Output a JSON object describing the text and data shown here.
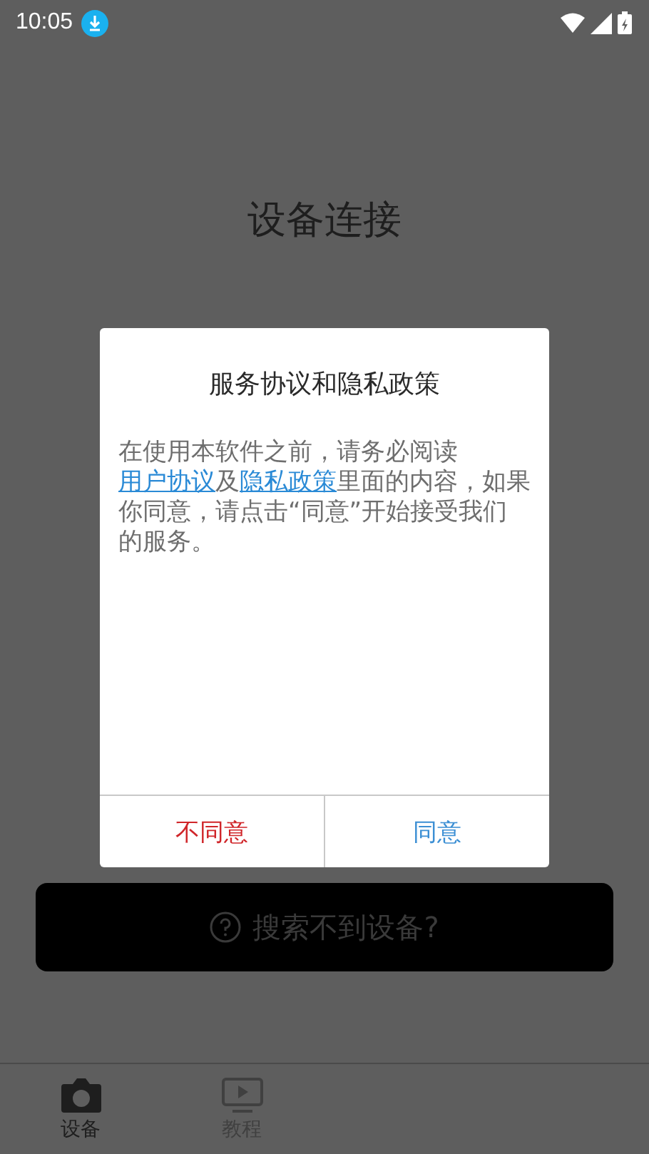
{
  "status_bar": {
    "time": "10:05"
  },
  "page": {
    "title": "设备连接",
    "search_button": "搜索不到设备?"
  },
  "dialog": {
    "title": "服务协议和隐私政策",
    "body": [
      {
        "kind": "text",
        "text": "在使用本软件之前，请务必阅读"
      },
      {
        "kind": "link",
        "text": "用户协议"
      },
      {
        "kind": "text",
        "text": "及"
      },
      {
        "kind": "link",
        "text": "隐私政策"
      },
      {
        "kind": "text",
        "text": "里面的内容，如果你同意，请点击“同意”开始接受我们的服务。"
      }
    ],
    "buttons": [
      {
        "kind": "decline",
        "label": "不同意"
      },
      {
        "kind": "accept",
        "label": "同意"
      }
    ]
  },
  "bottom_nav": [
    {
      "label": "设备",
      "kind": "camera",
      "selected": true
    },
    {
      "label": "教程",
      "kind": "video",
      "selected": false
    }
  ]
}
